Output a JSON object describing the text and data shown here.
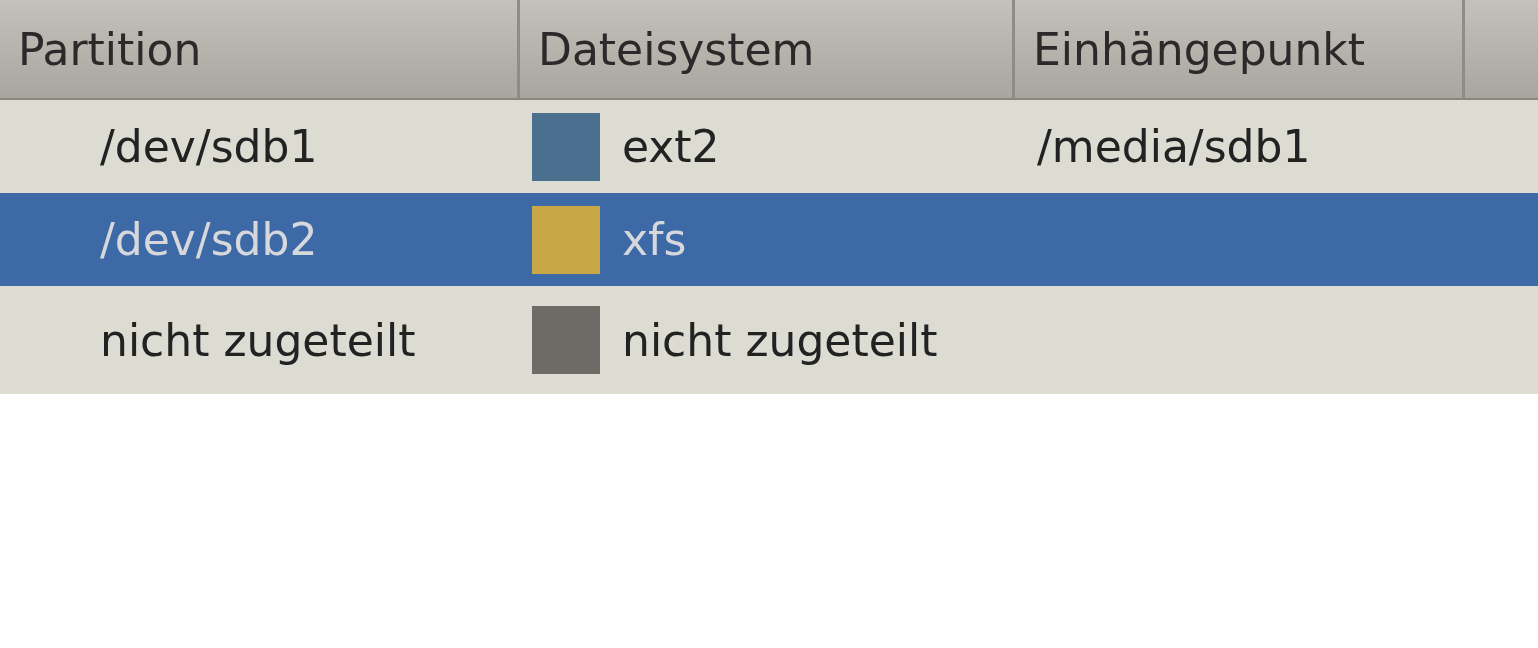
{
  "table": {
    "columns": [
      "Partition",
      "Dateisystem",
      "Einhängepunkt"
    ],
    "rows": [
      {
        "partition": "/dev/sdb1",
        "filesystem": "ext2",
        "color": "#4a6f8f",
        "mountpoint": "/media/sdb1",
        "selected": false
      },
      {
        "partition": "/dev/sdb2",
        "filesystem": "xfs",
        "color": "#c9a646",
        "selected": true
      },
      {
        "partition": "nicht zugeteilt",
        "filesystem": "nicht zugeteilt",
        "color": "#6e6a66",
        "selected": false
      }
    ]
  }
}
